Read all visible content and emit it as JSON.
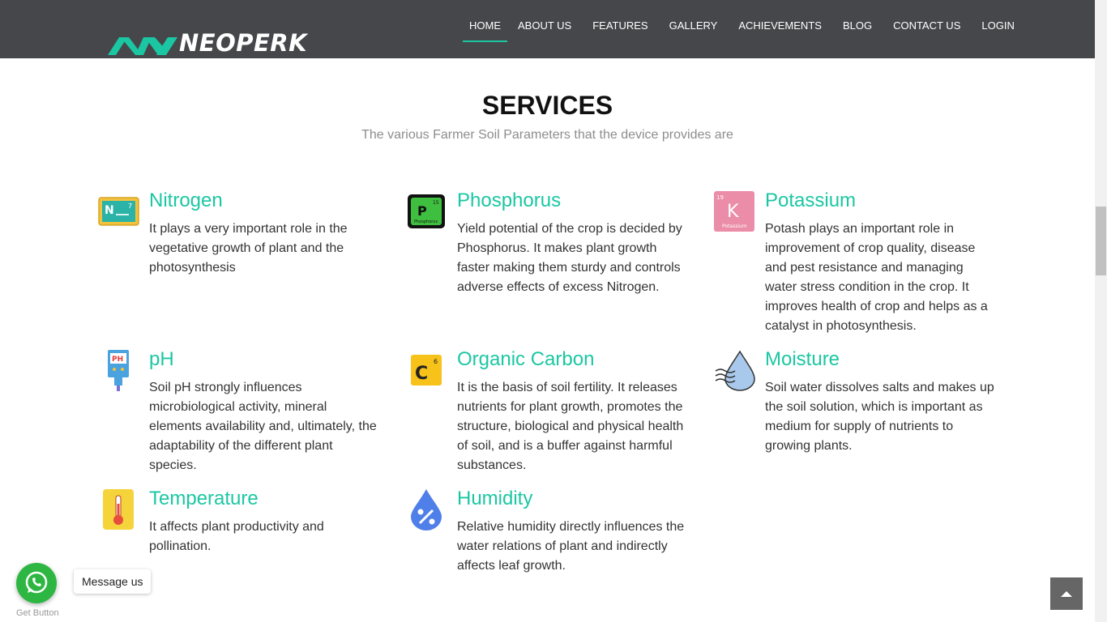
{
  "header": {
    "logo_text": "NEOPERK",
    "nav": [
      {
        "label": "HOME"
      },
      {
        "label": "ABOUT US"
      },
      {
        "label": "FEATURES"
      },
      {
        "label": "GALLERY"
      },
      {
        "label": "ACHIEVEMENTS"
      },
      {
        "label": "BLOG"
      },
      {
        "label": "CONTACT US"
      },
      {
        "label": "LOGIN"
      }
    ]
  },
  "services": {
    "title": "SERVICES",
    "subtitle": "The various Farmer Soil Parameters that the device provides are",
    "items": [
      {
        "title": "Nitrogen",
        "desc": "It plays a very important role in the vegetative growth of plant and the photosynthesis",
        "icon": "nitrogen-icon"
      },
      {
        "title": "Phosphorus",
        "desc": "Yield potential of the crop is decided by Phosphorus. It makes plant growth faster making them sturdy and controls adverse effects of excess Nitrogen.",
        "icon": "phosphorus-icon"
      },
      {
        "title": "Potassium",
        "desc": "Potash plays an important role in improvement of crop quality, disease and pest resistance and managing water stress condition in the crop. It improves health of crop and helps as a catalyst in photosynthesis.",
        "icon": "potassium-icon"
      },
      {
        "title": "pH",
        "desc": "Soil pH strongly influences microbiological activity, mineral elements availability and, ultimately, the adaptability of the different plant species.",
        "icon": "ph-meter-icon"
      },
      {
        "title": "Organic Carbon",
        "desc": "It is the basis of soil fertility. It releases nutrients for plant growth, promotes the structure, biological and physical health of soil, and is a buffer against harmful substances.",
        "icon": "carbon-icon"
      },
      {
        "title": "Moisture",
        "desc": "Soil water dissolves salts and makes up the soil solution, which is important as medium for supply of nutrients to growing plants.",
        "icon": "moisture-drop-icon"
      },
      {
        "title": "Temperature",
        "desc": "It affects plant productivity and pollination.",
        "icon": "thermometer-icon"
      },
      {
        "title": "Humidity",
        "desc": "Relative humidity directly influences the water relations of plant and indirectly affects leaf growth.",
        "icon": "humidity-icon"
      }
    ]
  },
  "icon_text": {
    "nitrogen_symbol": "N",
    "nitrogen_number": "7",
    "phosphorus_symbol": "P",
    "phosphorus_number": "15",
    "phosphorus_name": "Phosphorus",
    "potassium_symbol": "K",
    "potassium_number": "19",
    "potassium_name": "Potassium",
    "ph_label": "PH",
    "carbon_symbol": "C",
    "carbon_number": "6"
  },
  "whatsapp": {
    "message": "Message us",
    "get_button": "Get Button"
  },
  "colors": {
    "header_bg": "#45474a",
    "accent": "#1bc7a3",
    "whatsapp": "#2db742"
  }
}
